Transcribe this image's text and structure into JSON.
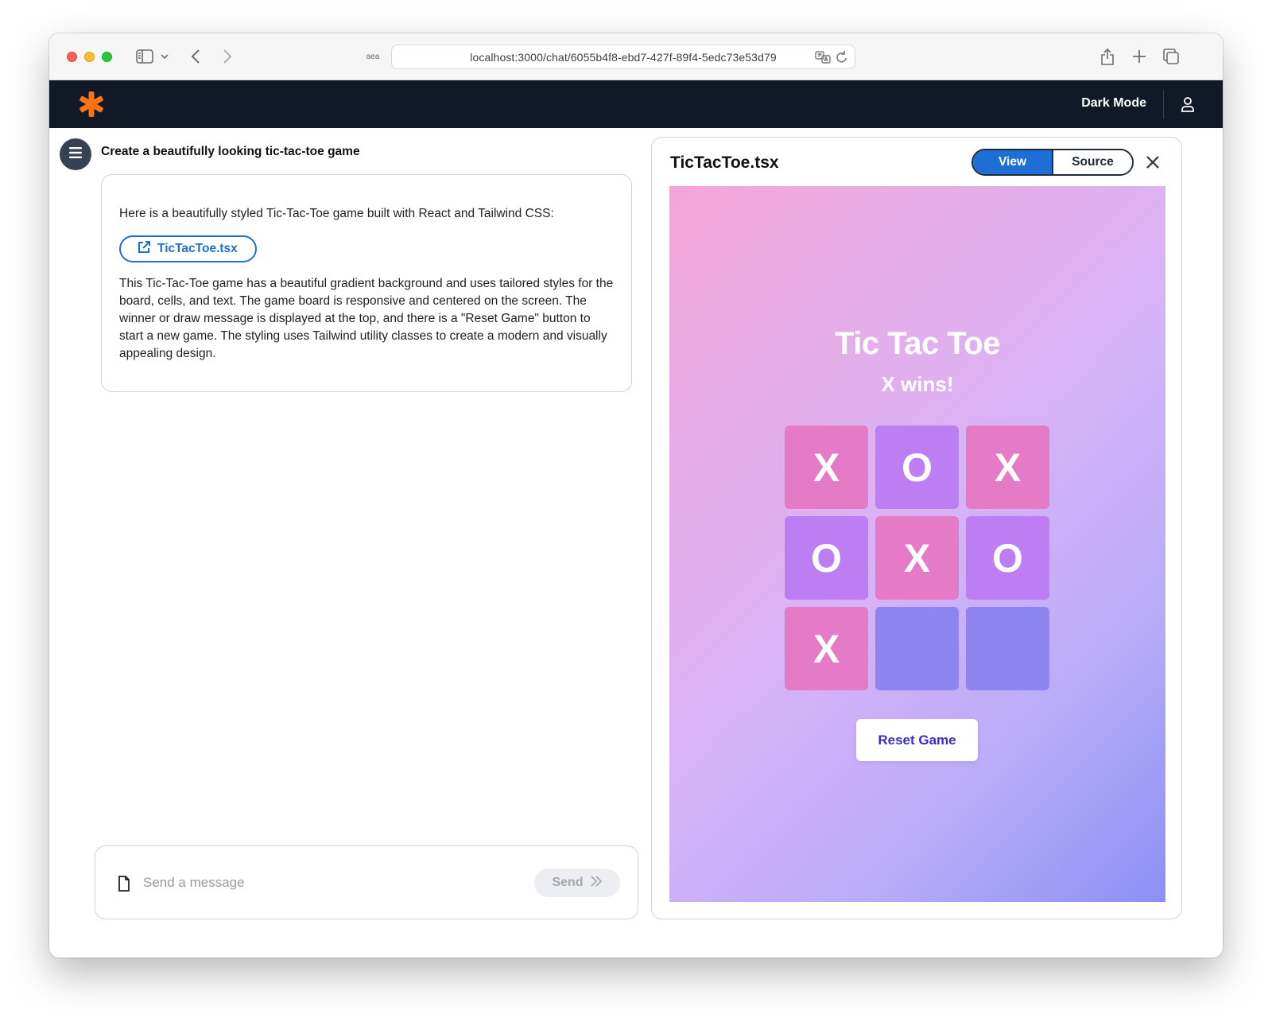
{
  "browser": {
    "url": "localhost:3000/chat/6055b4f8-ebd7-427f-89f4-5edc73e53d79",
    "aea_label": "aea"
  },
  "header": {
    "logo_icon": "asterisk-icon",
    "logo_color": "#f97316",
    "dark_mode_label": "Dark Mode",
    "background": "#111827"
  },
  "chat": {
    "prompt": "Create a beautifully looking tic-tac-toe game",
    "response": {
      "intro": "Here is a beautifully styled Tic-Tac-Toe game built with React and Tailwind CSS:",
      "file_link_label": "TicTacToe.tsx",
      "body": "This Tic-Tac-Toe game has a beautiful gradient background and uses tailored styles for the board, cells, and text. The game board is responsive and centered on the screen. The winner or draw message is displayed at the top, and there is a \"Reset Game\" button to start a new game. The styling uses Tailwind utility classes to create a modern and visually appealing design."
    },
    "composer": {
      "placeholder": "Send a message",
      "send_label": "Send"
    }
  },
  "preview": {
    "title": "TicTacToe.tsx",
    "view_label": "View",
    "source_label": "Source",
    "game": {
      "title": "Tic Tac Toe",
      "status": "X wins!",
      "board": [
        "X",
        "O",
        "X",
        "O",
        "X",
        "O",
        "X",
        "",
        ""
      ],
      "reset_label": "Reset Game"
    }
  },
  "colors": {
    "accent": "#1d6fd6",
    "x_cell": "#e57bc6",
    "o_cell": "#bd7df3",
    "empty_cell": "#8f85f0"
  }
}
